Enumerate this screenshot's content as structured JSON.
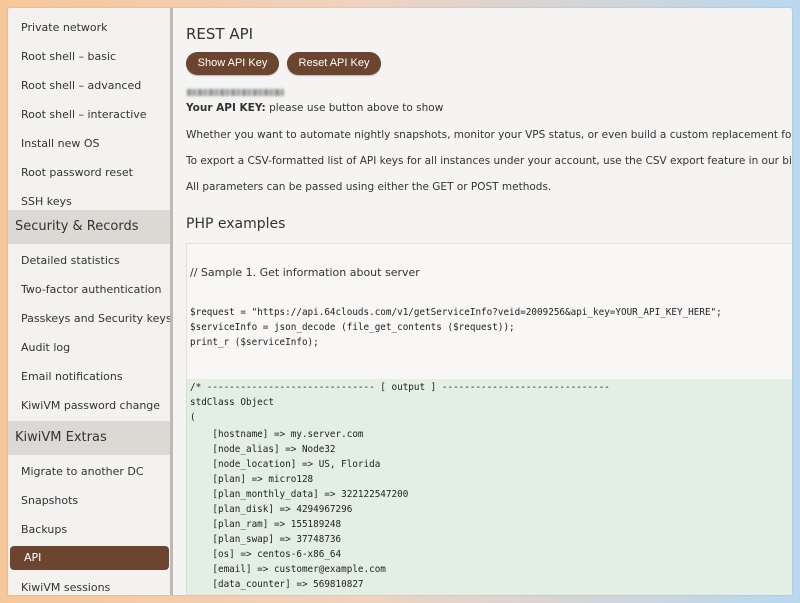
{
  "sidebar": {
    "items_top": [
      "Private network",
      "Root shell – basic",
      "Root shell – advanced",
      "Root shell – interactive",
      "Install new OS",
      "Root password reset",
      "SSH keys"
    ],
    "section_security": "Security & Records",
    "items_security": [
      "Detailed statistics",
      "Two-factor authentication",
      "Passkeys and Security keys",
      "Audit log",
      "Email notifications",
      "KiwiVM password change"
    ],
    "section_extras": "KiwiVM Extras",
    "items_extras": [
      "Migrate to another DC",
      "Snapshots",
      "Backups",
      "API",
      "KiwiVM sessions"
    ],
    "active_item": "API"
  },
  "main": {
    "title": "REST API",
    "show_key_button": "Show API Key",
    "reset_key_button": "Reset API Key",
    "api_key_label": "Your API KEY:",
    "api_key_hint": " please use button above to show",
    "para1": "Whether you want to automate nightly snapshots, monitor your VPS status, or even build a custom replacement for the KiwiVM panel, t",
    "para2": "To export a CSV-formatted list of API keys for all instances under your account, use the CSV export feature in our billing portal.",
    "para3": "All parameters can be passed using either the GET or POST methods.",
    "examples_title": "PHP examples",
    "sample_comment": "// Sample 1. Get information about server",
    "code_lines": [
      "$request = \"https://api.64clouds.com/v1/getServiceInfo?veid=2009256&api_key=YOUR_API_KEY_HERE\";",
      "$serviceInfo = json_decode (file_get_contents ($request));",
      "print_r ($serviceInfo);"
    ],
    "output_lines": [
      "/* ------------------------------ [ output ] ------------------------------",
      "stdClass Object",
      "(",
      "    [hostname] => my.server.com",
      "    [node_alias] => Node32",
      "    [node_location] => US, Florida",
      "    [plan] => micro128",
      "    [plan_monthly_data] => 322122547200",
      "    [plan_disk] => 4294967296",
      "    [plan_ram] => 155189248",
      "    [plan_swap] => 37748736",
      "    [os] => centos-6-x86_64",
      "    [email] => customer@example.com",
      "    [data_counter] => 569810827"
    ]
  },
  "colors": {
    "accent": "#6b4530",
    "output_bg": "#e3efe2"
  }
}
